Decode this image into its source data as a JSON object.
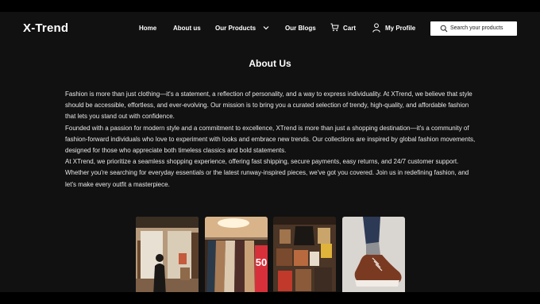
{
  "brand": "X-Trend",
  "nav": {
    "home": "Home",
    "about": "About us",
    "products": "Our Products",
    "blogs": "Our Blogs",
    "cart": "Cart",
    "profile": "My Profile"
  },
  "search": {
    "placeholder": "Search your products"
  },
  "page_title": "About Us",
  "about_paragraphs": [
    "Fashion is more than just clothing—it's a statement, a reflection of personality, and a way to express individuality. At XTrend, we believe that style should be accessible, effortless, and ever-evolving. Our mission is to bring you a curated selection of trendy, high-quality, and affordable fashion that lets you stand out with confidence.",
    "Founded with a passion for modern style and a commitment to excellence, XTrend is more than just a shopping destination—it's a community of fashion-forward individuals who love to experiment with looks and embrace new trends. Our collections are inspired by global fashion movements, designed for those who appreciate both timeless classics and bold statements.",
    "At XTrend, we prioritize a seamless shopping experience, offering fast shipping, secure payments, easy returns, and 24/7 customer support. Whether you're searching for everyday essentials or the latest runway-inspired pieces, we've got you covered. Join us in redefining fashion, and let's make every outfit a masterpiece."
  ],
  "gallery": {
    "sale_sign": "50"
  }
}
